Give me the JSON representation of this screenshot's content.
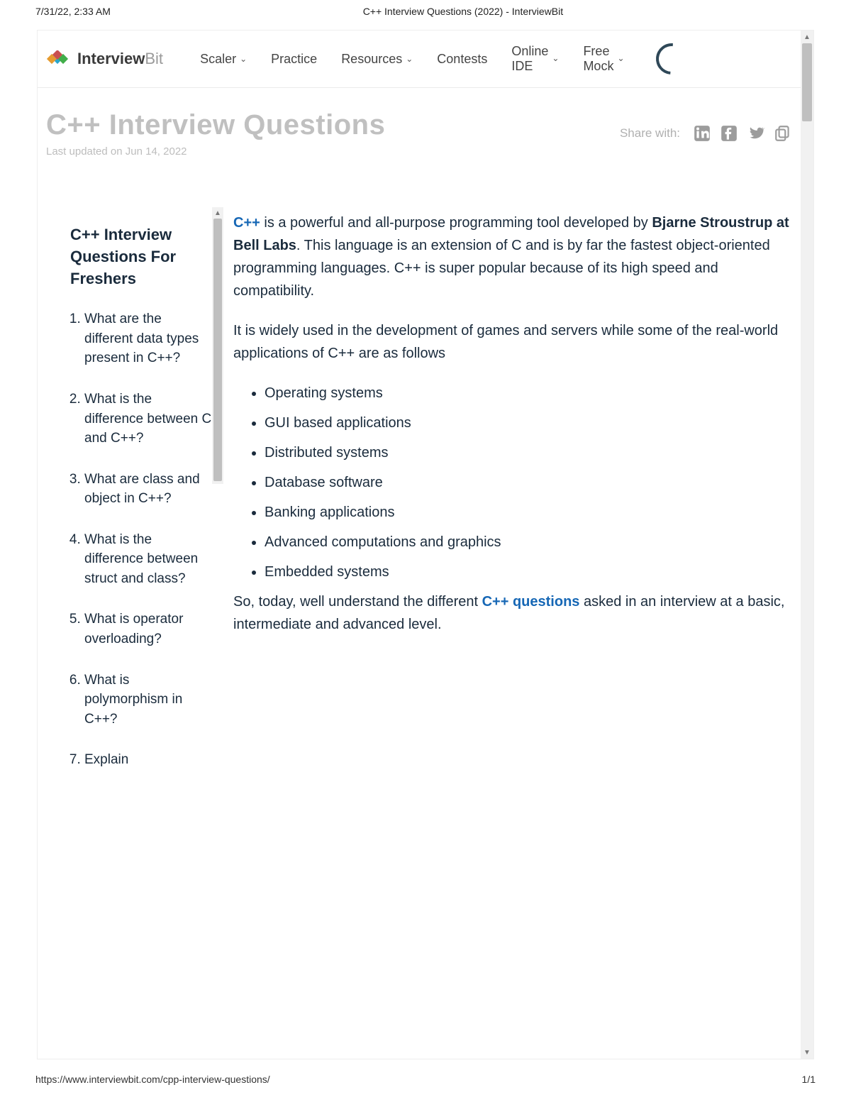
{
  "print": {
    "datetime": "7/31/22, 2:33 AM",
    "doc_title": "C++ Interview Questions (2022) - InterviewBit",
    "url": "https://www.interviewbit.com/cpp-interview-questions/",
    "page": "1/1"
  },
  "brand": {
    "name": "Interview",
    "suffix": "Bit"
  },
  "nav": {
    "scaler": "Scaler",
    "practice": "Practice",
    "resources": "Resources",
    "contests": "Contests",
    "online_ide_l1": "Online",
    "online_ide_l2": "IDE",
    "free_mock_l1": "Free",
    "free_mock_l2": "Mock"
  },
  "header": {
    "title": "C++ Interview Questions",
    "updated": "Last updated on Jun 14, 2022",
    "share_label": "Share with:"
  },
  "sidebar": {
    "heading": "C++ Interview Questions For Freshers",
    "questions": [
      "What are the different data types present in C++?",
      "What is the difference between C and C++?",
      "What are class and object in C++?",
      "What is the difference between struct and class?",
      "What is operator overloading?",
      "What is polymorphism in C++?",
      "Explain"
    ]
  },
  "article": {
    "p1_link": "C++",
    "p1_a": " is a powerful and all-purpose programming tool developed by ",
    "p1_bold": "Bjarne Stroustrup at Bell Labs",
    "p1_b": ". This language is an extension of C and is by far the fastest object-oriented programming languages. C++ is super popular because of its high speed and compatibility.",
    "p2": "It is widely used in the development of games and servers while some of the real-world applications of C++ are as follows",
    "bullets": [
      "Operating systems",
      "GUI based applications",
      "Distributed systems",
      "Database software",
      "Banking applications",
      "Advanced computations and graphics",
      "Embedded systems"
    ],
    "p3_a": "So, today, well understand the different ",
    "p3_link": "C++ questions",
    "p3_b": " asked in an interview at a basic, intermediate and advanced level."
  }
}
